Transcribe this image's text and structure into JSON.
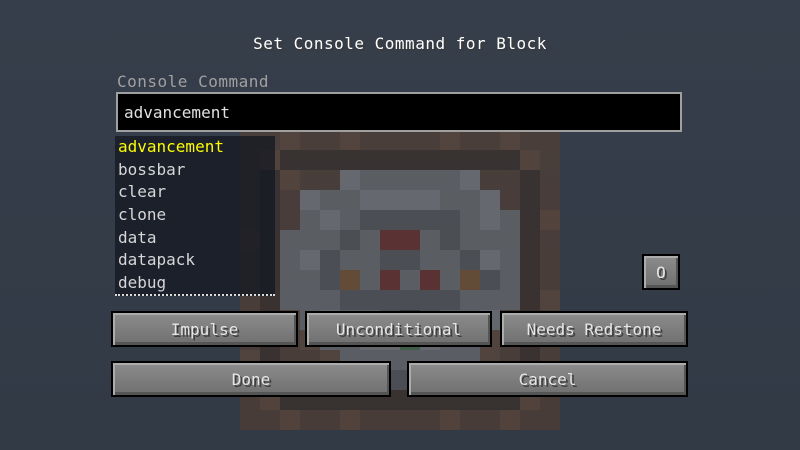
{
  "dialog": {
    "title": "Set Console Command for Block",
    "field_label": "Console Command",
    "command_value": "advancement"
  },
  "suggestions": [
    {
      "label": "advancement",
      "selected": true
    },
    {
      "label": "bossbar",
      "selected": false
    },
    {
      "label": "clear",
      "selected": false
    },
    {
      "label": "clone",
      "selected": false
    },
    {
      "label": "data",
      "selected": false
    },
    {
      "label": "datapack",
      "selected": false
    },
    {
      "label": "debug",
      "selected": false
    }
  ],
  "buttons": {
    "mode": "Impulse",
    "conditional": "Unconditional",
    "redstone": "Needs Redstone",
    "done": "Done",
    "cancel": "Cancel",
    "previous_output": "O"
  },
  "colors": {
    "background": "#343c48",
    "selected_suggestion": "#fcfc00",
    "input_background": "#000000",
    "button_face": "#7f7f7f"
  }
}
